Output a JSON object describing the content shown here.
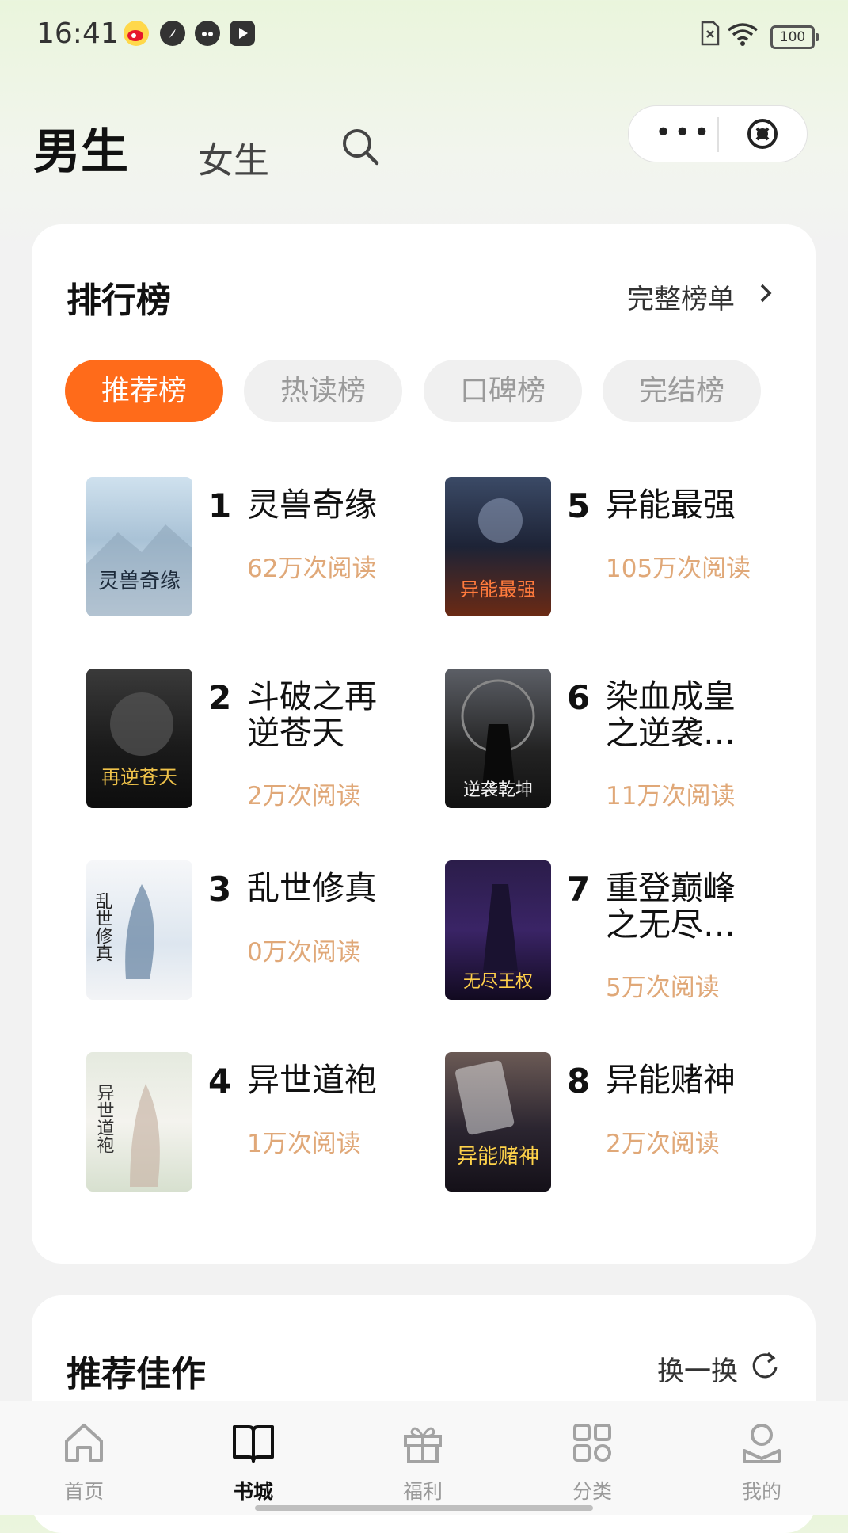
{
  "status": {
    "time": "16:41",
    "battery": "100"
  },
  "top_tabs": {
    "male": "男生",
    "female": "女生"
  },
  "ranking": {
    "title": "排行榜",
    "more": "完整榜单",
    "chips": [
      "推荐榜",
      "热读榜",
      "口碑榜",
      "完结榜"
    ],
    "left": [
      {
        "rank": "1",
        "title": "灵兽奇缘",
        "reads": "62万次阅读",
        "cover": "灵兽奇缘"
      },
      {
        "rank": "2",
        "title": "斗破之再逆苍天",
        "reads": "2万次阅读",
        "cover": "再逆苍天"
      },
      {
        "rank": "3",
        "title": "乱世修真",
        "reads": "0万次阅读",
        "cover": "乱世修真"
      },
      {
        "rank": "4",
        "title": "异世道袍",
        "reads": "1万次阅读",
        "cover": "异世道袍"
      }
    ],
    "right": [
      {
        "rank": "5",
        "title": "异能最强",
        "reads": "105万次阅读",
        "cover": "异能最强"
      },
      {
        "rank": "6",
        "title": "染血成皇之逆袭…",
        "reads": "11万次阅读",
        "cover": "逆袭乾坤"
      },
      {
        "rank": "7",
        "title": "重登巅峰之无尽…",
        "reads": "5万次阅读",
        "cover": "无尽王权"
      },
      {
        "rank": "8",
        "title": "异能赌神",
        "reads": "2万次阅读",
        "cover": "异能赌神"
      }
    ]
  },
  "recommend": {
    "title": "推荐佳作",
    "swap": "换一换"
  },
  "bottom_nav": {
    "home": "首页",
    "bookstore": "书城",
    "welfare": "福利",
    "category": "分类",
    "mine": "我的"
  },
  "colors": {
    "accent": "#ff6b1a",
    "reads": "#e0a878"
  }
}
